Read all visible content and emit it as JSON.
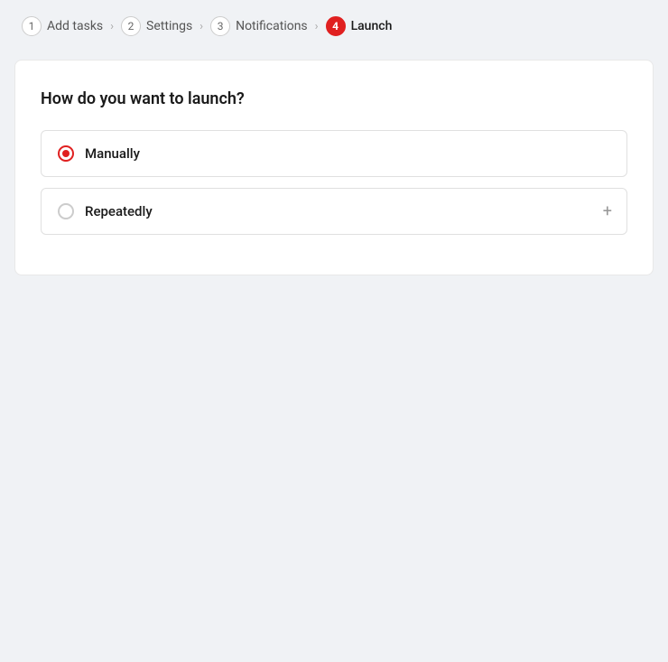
{
  "wizard": {
    "steps": [
      {
        "number": "1",
        "label": "Add tasks",
        "active": false
      },
      {
        "number": "2",
        "label": "Settings",
        "active": false
      },
      {
        "number": "3",
        "label": "Notifications",
        "active": false
      },
      {
        "number": "4",
        "label": "Launch",
        "active": true
      }
    ]
  },
  "section": {
    "title": "How do you want to launch?"
  },
  "options": [
    {
      "id": "manually",
      "label": "Manually",
      "checked": true
    },
    {
      "id": "repeatedly",
      "label": "Repeatedly",
      "checked": false
    }
  ],
  "icons": {
    "chevron": "›",
    "plus": "+"
  }
}
